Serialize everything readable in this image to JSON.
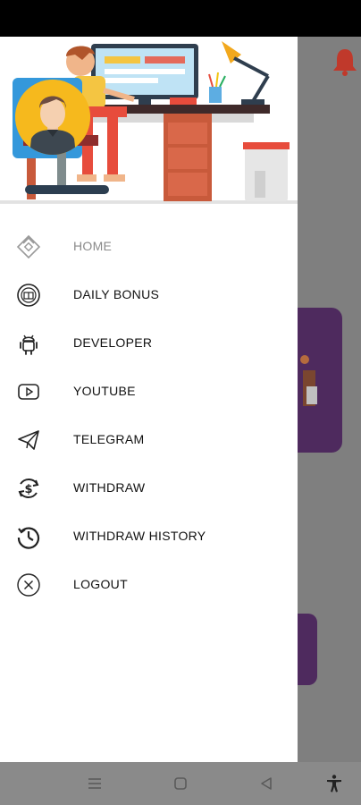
{
  "drawer": {
    "menu": [
      {
        "label": "HOME",
        "icon": "home-diamond-icon",
        "active": true
      },
      {
        "label": "DAILY BONUS",
        "icon": "gift-coin-icon"
      },
      {
        "label": "DEVELOPER",
        "icon": "android-icon"
      },
      {
        "label": "YOUTUBE",
        "icon": "youtube-icon"
      },
      {
        "label": "TELEGRAM",
        "icon": "telegram-icon"
      },
      {
        "label": "WITHDRAW",
        "icon": "withdraw-dollar-icon"
      },
      {
        "label": "WITHDRAW HISTORY",
        "icon": "history-icon"
      },
      {
        "label": "LOGOUT",
        "icon": "logout-icon"
      }
    ]
  },
  "colors": {
    "scrim": "#7f7f7f",
    "card": "#4e2a5e",
    "bell": "#c0392b",
    "avatar_bg": "#f6b91d",
    "active_label": "#8a8a8a"
  },
  "icons": {
    "bell": "bell-icon",
    "nav_menu": "menu-lines-icon",
    "nav_home": "square-home-icon",
    "nav_back": "triangle-back-icon",
    "nav_accessibility": "accessibility-icon"
  }
}
